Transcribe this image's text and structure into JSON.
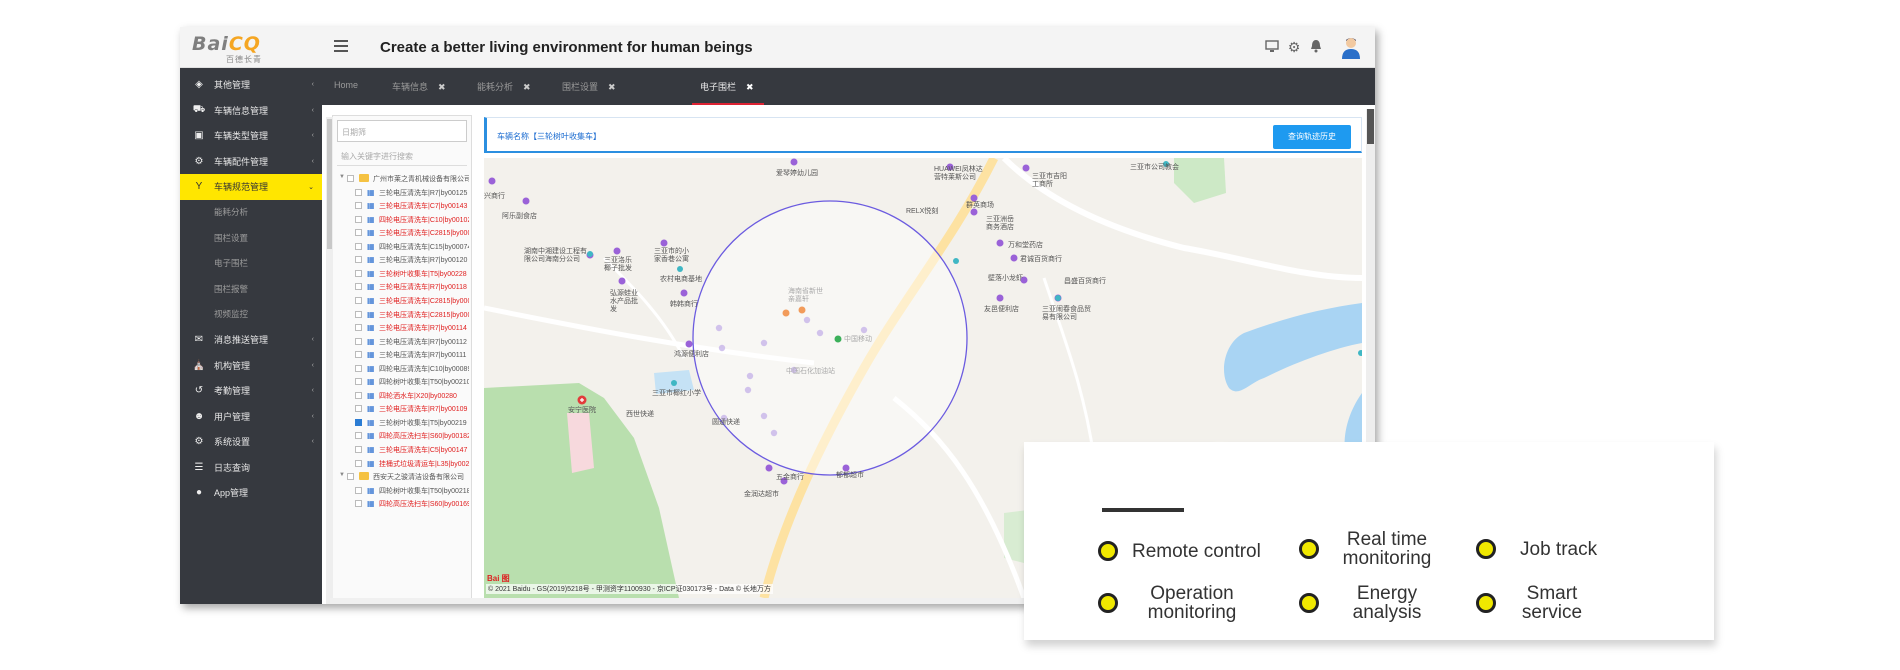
{
  "header": {
    "logo_text_a": "Bai",
    "logo_text_b": "CQ",
    "logo_sub": "百德长青",
    "title": "Create a better living environment for human beings",
    "icons": [
      "monitor-icon",
      "gear-icon",
      "bell-icon",
      "user-avatar"
    ]
  },
  "sidebar": {
    "items": [
      {
        "label": "其他管理",
        "icon": "cubes-icon"
      },
      {
        "label": "车辆信息管理",
        "icon": "truck-icon"
      },
      {
        "label": "车辆类型管理",
        "icon": "cube-icon"
      },
      {
        "label": "车辆配件管理",
        "icon": "gear-icon"
      },
      {
        "label": "车辆规范管理",
        "icon": "filter-icon",
        "active": true
      },
      {
        "label": "消息推送管理",
        "icon": "envelope-icon"
      },
      {
        "label": "机构管理",
        "icon": "bank-icon"
      },
      {
        "label": "考勤管理",
        "icon": "history-icon"
      },
      {
        "label": "用户管理",
        "icon": "users-icon"
      },
      {
        "label": "系统设置",
        "icon": "gears-icon"
      },
      {
        "label": "日志查询",
        "icon": "list-icon"
      },
      {
        "label": "App管理",
        "icon": "android-icon"
      }
    ],
    "sub_items": [
      "能耗分析",
      "围栏设置",
      "电子围栏",
      "围栏报警",
      "视频监控"
    ]
  },
  "tabs": [
    {
      "label": "Home",
      "closable": false
    },
    {
      "label": "车辆信息",
      "closable": true
    },
    {
      "label": "能耗分析",
      "closable": true
    },
    {
      "label": "围栏设置",
      "closable": true
    },
    {
      "label": "电子围栏",
      "closable": true,
      "active": true
    }
  ],
  "tree": {
    "search_placeholder": "日期筛",
    "filter_placeholder": "输入关键字进行搜索",
    "rows": [
      {
        "type": "group",
        "label": "广州市莱之青机械设备有限公司",
        "red": false
      },
      {
        "type": "item",
        "label": "三轮电压清洗车|R7|by00125",
        "red": false
      },
      {
        "type": "item",
        "label": "三轮电压清洗车|C7|by00143",
        "red": true
      },
      {
        "type": "item",
        "label": "四轮电压清洗车|C10|by00102",
        "red": true
      },
      {
        "type": "item",
        "label": "三轮电压清洗车|C2815|by00017",
        "red": true
      },
      {
        "type": "item",
        "label": "四轮电压清洗车|C15|by00074",
        "red": false
      },
      {
        "type": "item",
        "label": "三轮电压清洗车|R7|by00120",
        "red": false
      },
      {
        "type": "item",
        "label": "三轮树叶收集车|T5|by00228",
        "red": true
      },
      {
        "type": "item",
        "label": "三轮电压清洗车|R7|by00118",
        "red": true
      },
      {
        "type": "item",
        "label": "三轮电压清洗车|C2815|by00002",
        "red": true
      },
      {
        "type": "item",
        "label": "三轮电压清洗车|C2815|by00031",
        "red": true
      },
      {
        "type": "item",
        "label": "三轮电压清洗车|R7|by00114",
        "red": true
      },
      {
        "type": "item",
        "label": "三轮电压清洗车|R7|by00112",
        "red": false
      },
      {
        "type": "item",
        "label": "三轮电压清洗车|R7|by00111",
        "red": false
      },
      {
        "type": "item",
        "label": "四轮电压清洗车|C10|by00089",
        "red": false
      },
      {
        "type": "item",
        "label": "四轮树叶收集车|T50|by00210",
        "red": false
      },
      {
        "type": "item",
        "label": "四轮洒水车|X20|by00280",
        "red": true
      },
      {
        "type": "item",
        "label": "三轮电压清洗车|R7|by00109",
        "red": true
      },
      {
        "type": "item",
        "label": "三轮树叶收集车|T5|by00219",
        "red": false,
        "checked": true
      },
      {
        "type": "item",
        "label": "四轮高压洗扫车|S60|by00182",
        "red": true
      },
      {
        "type": "item",
        "label": "三轮电压清洗车|C5|by00147",
        "red": true
      },
      {
        "type": "item",
        "label": "挂桶式垃圾清运车|L35|by00289",
        "red": true
      },
      {
        "type": "group",
        "label": "西安天之骏清洁设备有限公司",
        "red": false
      },
      {
        "type": "item",
        "label": "四轮树叶收集车|T50|by00218",
        "red": false
      },
      {
        "type": "item",
        "label": "四轮高压洗扫车|S60|by00169",
        "red": true
      }
    ]
  },
  "query": {
    "vehicle_name": "车辆名称【三轮树叶收集车】",
    "history_button": "查询轨迹历史"
  },
  "map": {
    "copyright": "© 2021 Baidu - GS(2019)5218号 - 甲测资字1100930 - 京ICP证030173号 - Data © 长地万方",
    "logo": "Bai 图",
    "poi_labels": [
      "爱琴婷幼儿园",
      "兴商行",
      "阿乐副食店",
      "湖南中湘建设工程有限公司海南分公司",
      "三亚洛乐椰子批发",
      "三亚市的小家香巷公寓",
      "农村电商基地",
      "弘源蛙业水产品批发",
      "韩韩商行",
      "鸿源便利店",
      "安宁医院",
      "西世快递",
      "圆通快递",
      "金润达超市",
      "HUAWEI凤林达营特莱斯公司",
      "群英商场",
      "RELX悦刻",
      "三亚洲岳商务酒店",
      "万和堂药店",
      "君诚百货商行",
      "壁落小龙虾",
      "昌盛百货商行",
      "友邑便利店",
      "三亚闹春食品贸易有限公司",
      "三亚市吉阳工商所",
      "三亚市公司教会",
      "三亚市椰红小学",
      "海南省新世亲嘉轩",
      "五金商行",
      "郁郁超市",
      "中国石化加油站",
      "中国移动"
    ]
  },
  "features": [
    {
      "label": "Remote control"
    },
    {
      "label": "Real time monitoring"
    },
    {
      "label": "Job track"
    },
    {
      "label": "Operation monitoring"
    },
    {
      "label": "Energy analysis"
    },
    {
      "label": "Smart service"
    }
  ],
  "colors": {
    "sidebar_bg": "#36393f",
    "active_yellow": "#ffe600",
    "accent_blue": "#1e9af0",
    "fence_circle": "#6b5be0",
    "feature_dot": "#f0e800"
  }
}
